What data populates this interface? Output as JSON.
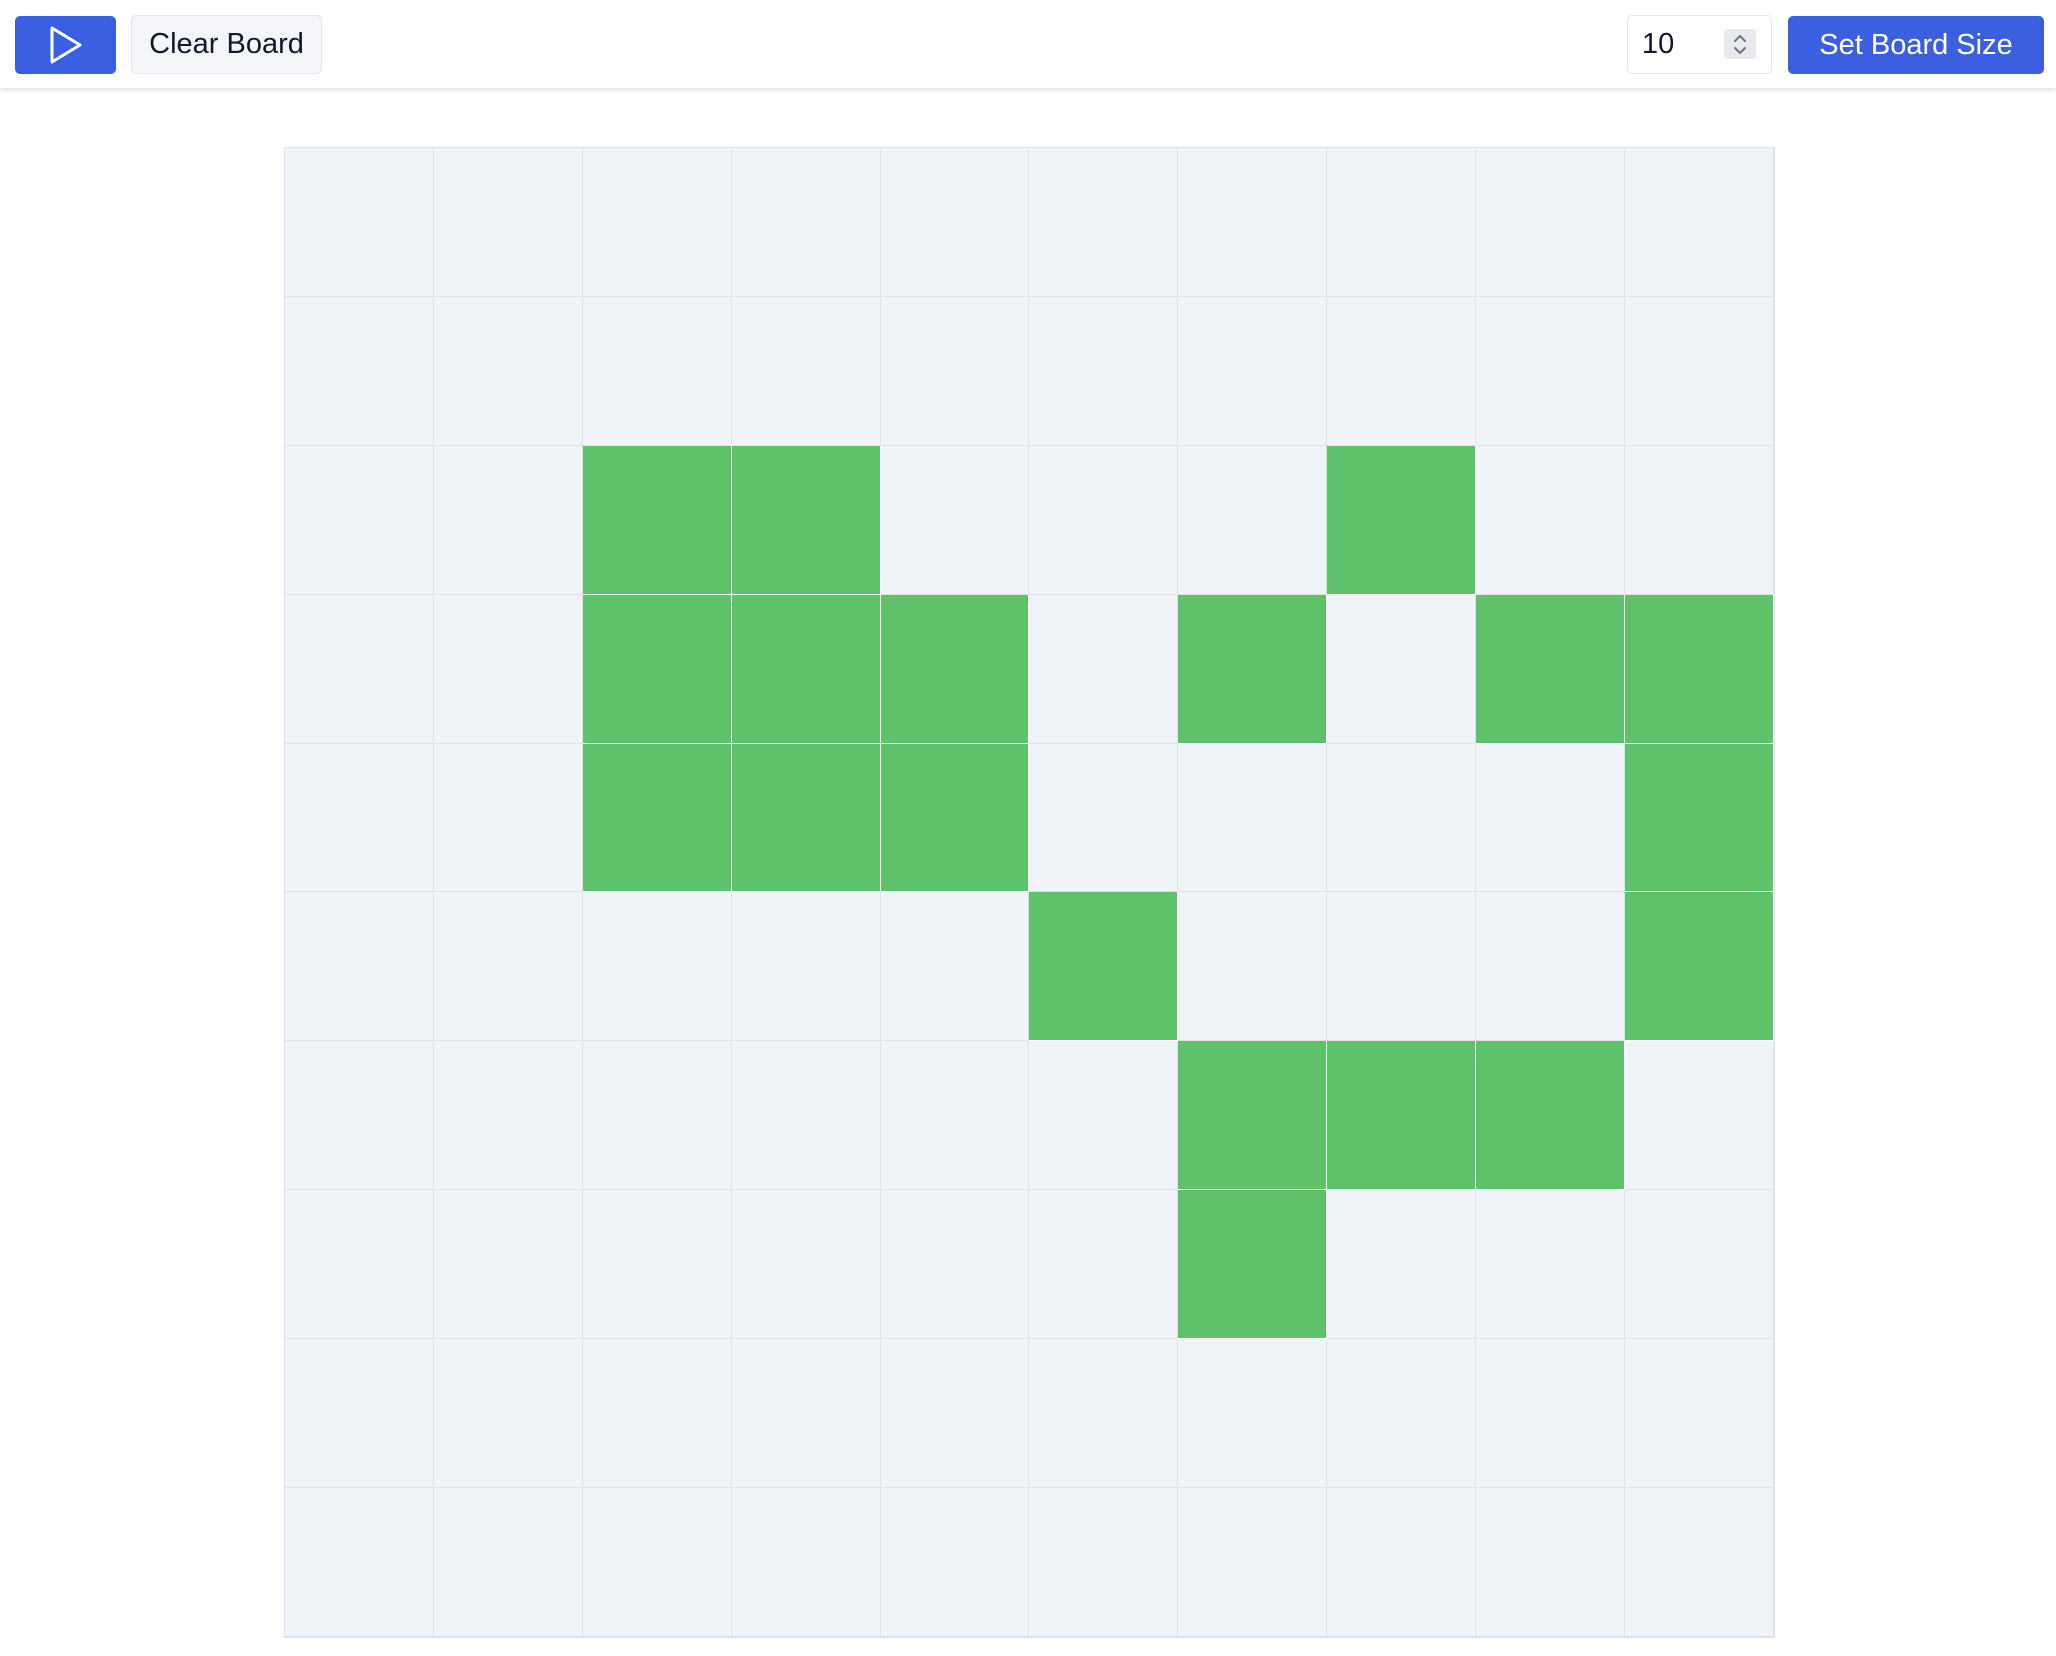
{
  "toolbar": {
    "play_icon": "play-icon",
    "clear_label": "Clear Board",
    "board_size_value": "10",
    "set_size_label": "Set Board Size"
  },
  "colors": {
    "accent": "#3b5fe0",
    "alive": "#5ec26a",
    "dead": "#f0f3f8",
    "grid_line": "#dfe3e8"
  },
  "board": {
    "size": 10,
    "rows": [
      [
        0,
        0,
        0,
        0,
        0,
        0,
        0,
        0,
        0,
        0
      ],
      [
        0,
        0,
        0,
        0,
        0,
        0,
        0,
        0,
        0,
        0
      ],
      [
        0,
        0,
        1,
        1,
        0,
        0,
        0,
        1,
        0,
        0
      ],
      [
        0,
        0,
        1,
        1,
        1,
        0,
        1,
        0,
        1,
        1
      ],
      [
        0,
        0,
        1,
        1,
        1,
        0,
        0,
        0,
        0,
        1
      ],
      [
        0,
        0,
        0,
        0,
        0,
        1,
        0,
        0,
        0,
        1
      ],
      [
        0,
        0,
        0,
        0,
        0,
        0,
        1,
        1,
        1,
        0
      ],
      [
        0,
        0,
        0,
        0,
        0,
        0,
        1,
        0,
        0,
        0
      ],
      [
        0,
        0,
        0,
        0,
        0,
        0,
        0,
        0,
        0,
        0
      ],
      [
        0,
        0,
        0,
        0,
        0,
        0,
        0,
        0,
        0,
        0
      ]
    ]
  }
}
